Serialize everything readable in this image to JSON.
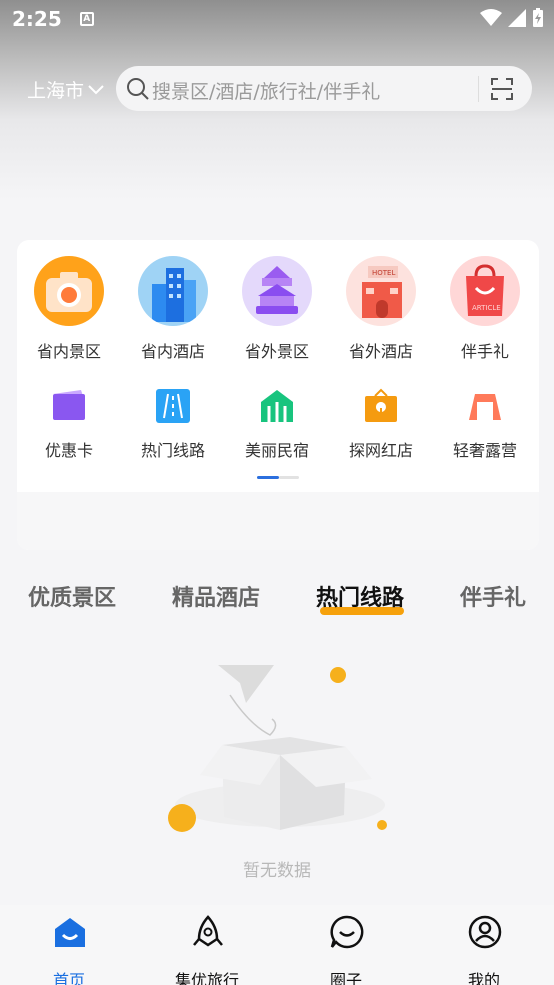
{
  "status_bar": {
    "time": "2:25",
    "a_icon_letter": "A"
  },
  "header": {
    "city": "上海市",
    "search_placeholder": "搜景区/酒店/旅行社/伴手礼"
  },
  "categories_row1": [
    {
      "label": "省内景区",
      "icon": "camera-icon"
    },
    {
      "label": "省内酒店",
      "icon": "building-icon"
    },
    {
      "label": "省外景区",
      "icon": "temple-icon"
    },
    {
      "label": "省外酒店",
      "icon": "hotel-icon"
    },
    {
      "label": "伴手礼",
      "icon": "gift-bag-icon"
    }
  ],
  "categories_row2": [
    {
      "label": "优惠卡",
      "icon": "card-icon"
    },
    {
      "label": "热门线路",
      "icon": "road-icon"
    },
    {
      "label": "美丽民宿",
      "icon": "house-icon"
    },
    {
      "label": "探网红店",
      "icon": "shop-icon"
    },
    {
      "label": "轻奢露营",
      "icon": "tent-icon"
    }
  ],
  "tabs": [
    {
      "label": "优质景区",
      "active": false
    },
    {
      "label": "精品酒店",
      "active": false
    },
    {
      "label": "热门线路",
      "active": true
    },
    {
      "label": "伴手礼",
      "active": false
    }
  ],
  "empty_state": {
    "text": "暂无数据"
  },
  "bottom_nav": [
    {
      "label": "首页",
      "icon": "home-icon",
      "active": true
    },
    {
      "label": "集优旅行",
      "icon": "rocket-icon",
      "active": false
    },
    {
      "label": "圈子",
      "icon": "chat-icon",
      "active": false
    },
    {
      "label": "我的",
      "icon": "profile-icon",
      "active": false
    }
  ],
  "colors": {
    "accent_blue": "#1a6fe0",
    "tab_underline": "#f6a10c"
  }
}
